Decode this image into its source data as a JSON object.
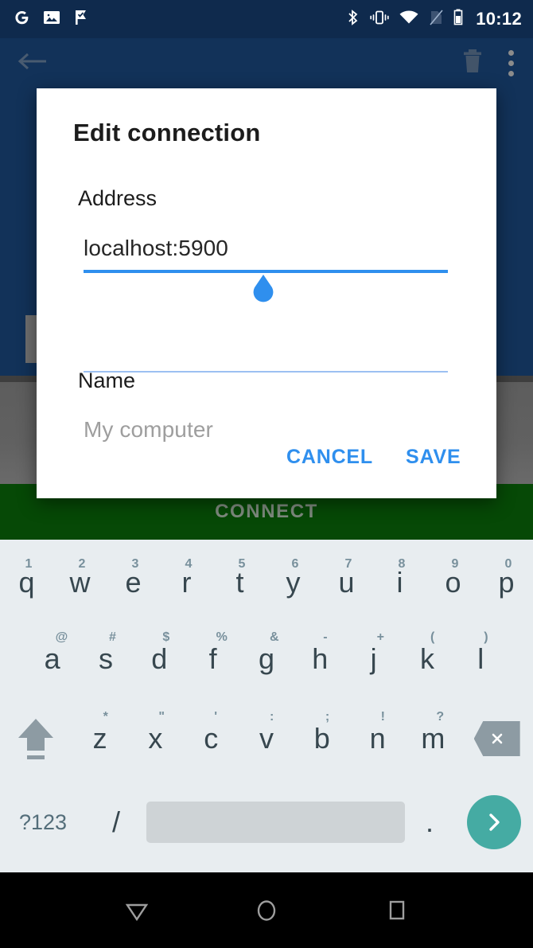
{
  "status_bar": {
    "time": "10:12",
    "left_icons": [
      "google-g-icon",
      "photos-icon",
      "tasks-flag-check-icon"
    ],
    "right_icons": [
      "bluetooth-icon",
      "vibrate-icon",
      "wifi-icon",
      "no-sim-icon",
      "battery-icon"
    ]
  },
  "app_bar": {
    "back_icon": "back-arrow-icon",
    "delete_icon": "trash-icon",
    "overflow_icon": "overflow-menu-icon"
  },
  "background": {
    "connect_label": "CONNECT"
  },
  "dialog": {
    "title": "Edit connection",
    "fields": [
      {
        "label": "Address",
        "value": "localhost:5900",
        "placeholder": ""
      },
      {
        "label": "Name",
        "value": "",
        "placeholder": "My computer"
      }
    ],
    "cancel_label": "CANCEL",
    "save_label": "SAVE",
    "accent_color": "#2f8fee",
    "handle_color": "#2f8fee"
  },
  "keyboard": {
    "row1": [
      {
        "main": "q",
        "alt": "1"
      },
      {
        "main": "w",
        "alt": "2"
      },
      {
        "main": "e",
        "alt": "3"
      },
      {
        "main": "r",
        "alt": "4"
      },
      {
        "main": "t",
        "alt": "5"
      },
      {
        "main": "y",
        "alt": "6"
      },
      {
        "main": "u",
        "alt": "7"
      },
      {
        "main": "i",
        "alt": "8"
      },
      {
        "main": "o",
        "alt": "9"
      },
      {
        "main": "p",
        "alt": "0"
      }
    ],
    "row2": [
      {
        "main": "a",
        "alt": "@"
      },
      {
        "main": "s",
        "alt": "#"
      },
      {
        "main": "d",
        "alt": "$"
      },
      {
        "main": "f",
        "alt": "%"
      },
      {
        "main": "g",
        "alt": "&"
      },
      {
        "main": "h",
        "alt": "-"
      },
      {
        "main": "j",
        "alt": "+"
      },
      {
        "main": "k",
        "alt": "("
      },
      {
        "main": "l",
        "alt": ")"
      }
    ],
    "row3": [
      {
        "main": "z",
        "alt": "*"
      },
      {
        "main": "x",
        "alt": "\""
      },
      {
        "main": "c",
        "alt": "'"
      },
      {
        "main": "v",
        "alt": ":"
      },
      {
        "main": "b",
        "alt": ";"
      },
      {
        "main": "n",
        "alt": "!"
      },
      {
        "main": "m",
        "alt": "?"
      }
    ],
    "shift_icon": "shift-icon",
    "backspace_icon": "backspace-icon",
    "symbols_label": "?123",
    "slash_label": "/",
    "space_label": "",
    "period_label": ".",
    "enter_icon": "chevron-right-icon",
    "enter_color": "#45aba3"
  },
  "nav_bar": {
    "back_icon": "nav-back-triangle-icon",
    "home_icon": "nav-home-circle-icon",
    "recents_icon": "nav-recents-square-icon"
  }
}
